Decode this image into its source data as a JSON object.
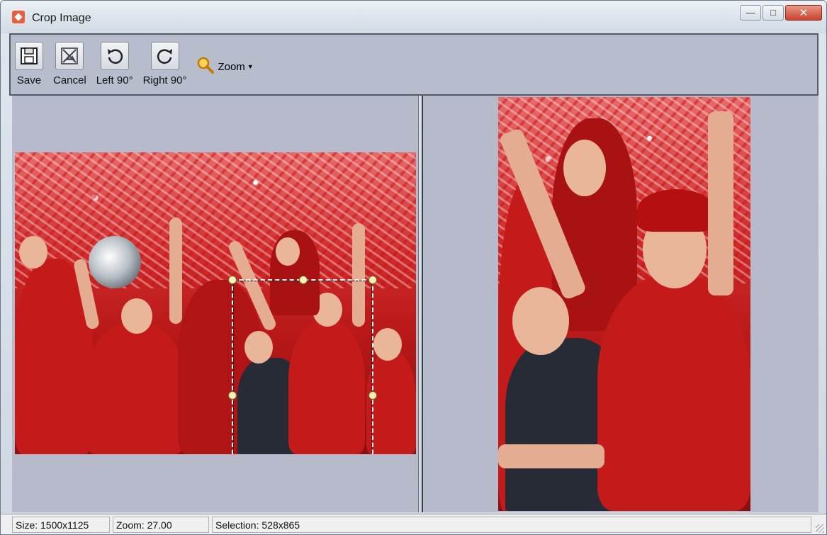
{
  "window": {
    "title": "Crop Image"
  },
  "toolbar": {
    "save_label": "Save",
    "cancel_label": "Cancel",
    "left90_label": "Left 90°",
    "right90_label": "Right 90°",
    "zoom_label": "Zoom"
  },
  "status": {
    "size": "Size: 1500x1125",
    "zoom": "Zoom: 27.00",
    "selection": "Selection: 528x865"
  },
  "icons": {
    "app": "app-icon",
    "save": "floppy-disk-icon",
    "cancel": "cancel-crop-icon",
    "rotate_left": "rotate-left-icon",
    "rotate_right": "rotate-right-icon",
    "zoom": "magnifier-icon"
  },
  "colors": {
    "pane_background": "#b6bacb",
    "toolbar_background": "#b8bdcd",
    "selection_border": "#ffffff",
    "handle_fill": "#f7f0b0"
  }
}
